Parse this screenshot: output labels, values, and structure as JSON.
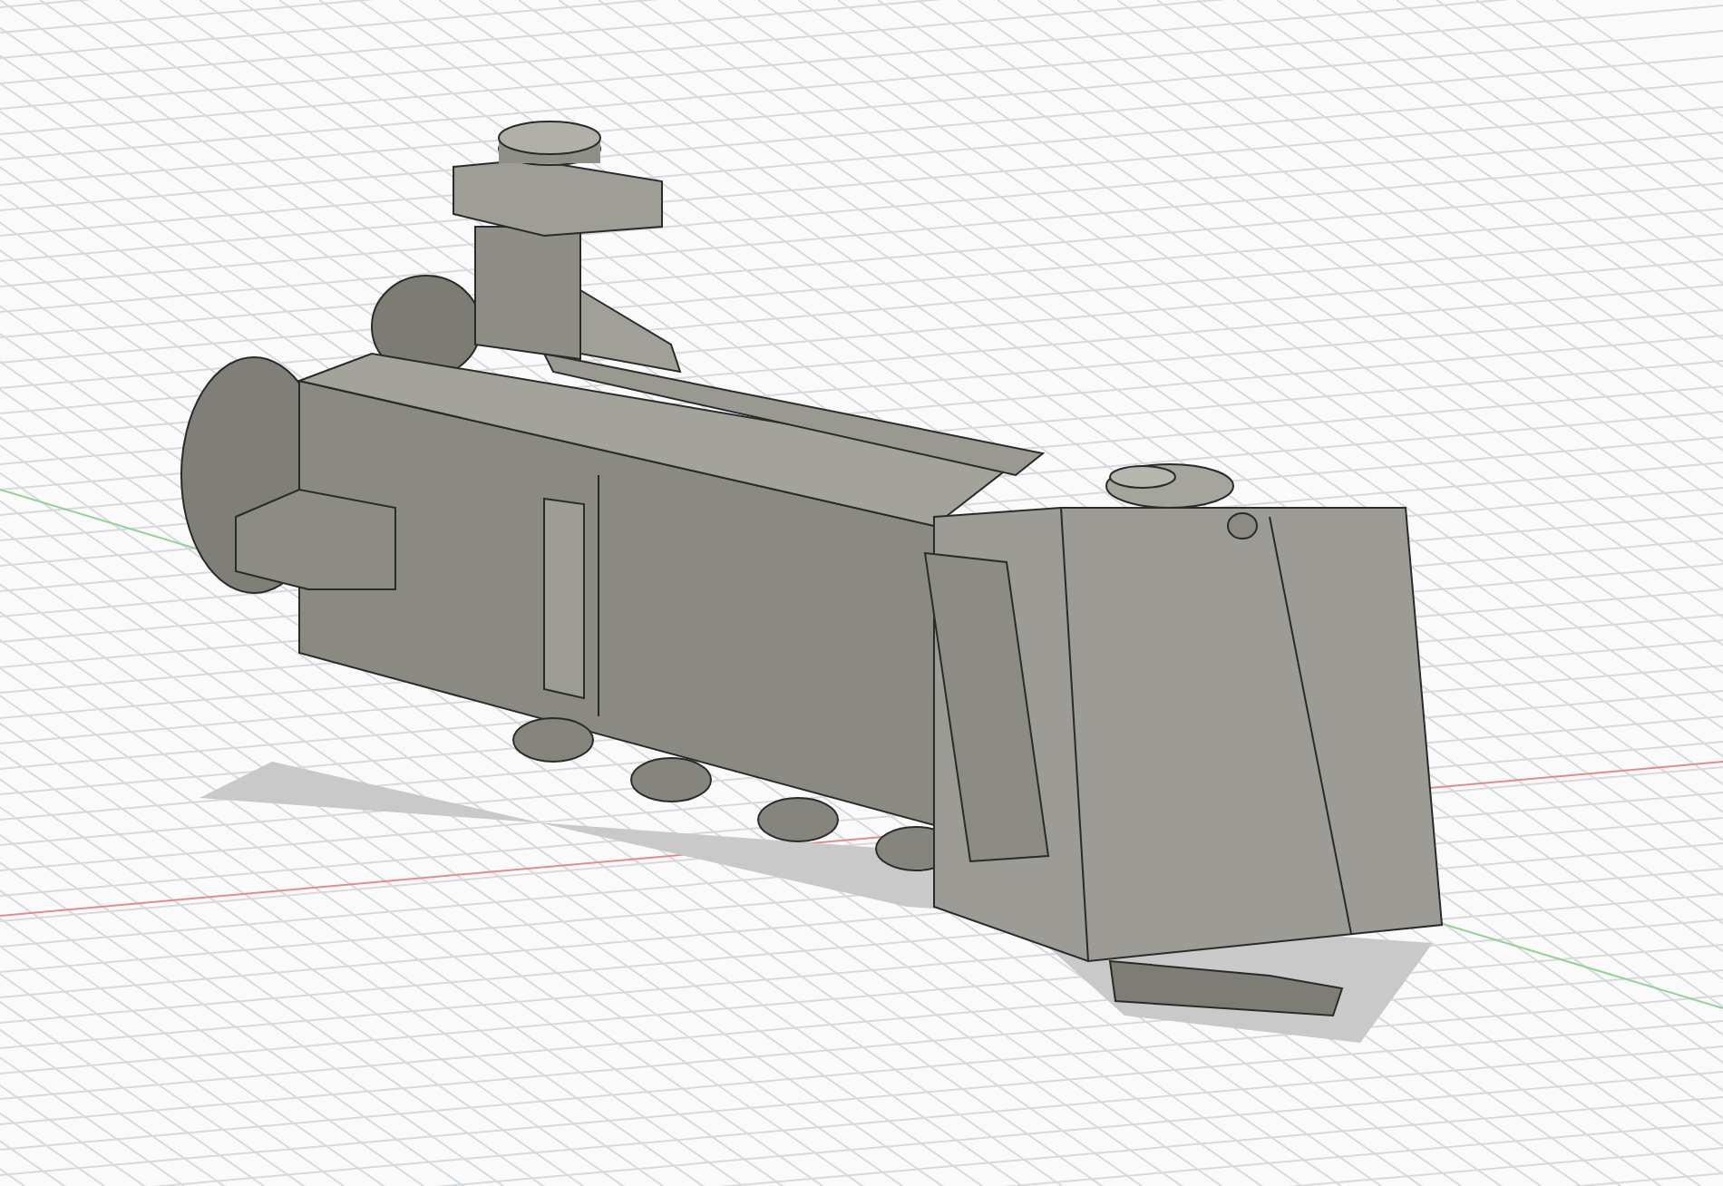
{
  "viewport": {
    "grid_visible": true
  }
}
